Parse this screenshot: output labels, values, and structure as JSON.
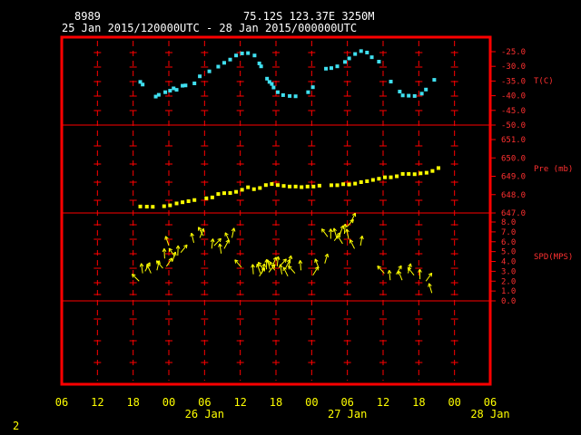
{
  "header": {
    "station_id": "8989",
    "location": "75.12S   123.37E   3250M",
    "date_range": "25 Jan 2015/120000UTC - 28 Jan 2015/000000UTC"
  },
  "page_number": "2",
  "colors": {
    "frame": "#ff0000",
    "grid": "#ff0000",
    "axis_text": "#ffff00",
    "header_text": "#ffffff",
    "temperature": "#40e0f0",
    "pressure": "#ffff00",
    "wind": "#ffff00",
    "right_labels": "#ff3030"
  },
  "chart_data": [
    {
      "type": "scatter",
      "ylabel": "T(C)",
      "ylim": [
        -50,
        -25
      ],
      "ticks": [
        "-25.0",
        "-30.0",
        "-35.0",
        "-40.0",
        "-45.0",
        "-50.0"
      ],
      "x": [
        13.2,
        13.6,
        15.8,
        16.3,
        17.4,
        18.2,
        18.8,
        19.3,
        20.3,
        20.8,
        22.3,
        23.2,
        24.8,
        26.3,
        27.3,
        28.3,
        29.3,
        30.3,
        31.3,
        32.4,
        33.2,
        33.5,
        34.5,
        34.9,
        35.3,
        35.6,
        36.3,
        37.2,
        38.3,
        39.3,
        41.4,
        42.2,
        44.4,
        45.3,
        46.3,
        47.6,
        48.3,
        49.3,
        50.3,
        51.3,
        52.1,
        53.3,
        55.3,
        56.8,
        57.3,
        58.3,
        59.3,
        60.5,
        61.2,
        62.6
      ],
      "y": [
        -35.3,
        -36.2,
        -40.3,
        -39.7,
        -38.8,
        -38.3,
        -37.5,
        -38.0,
        -36.6,
        -36.5,
        -35.8,
        -33.4,
        -31.7,
        -30.1,
        -28.8,
        -27.7,
        -26.3,
        -25.6,
        -25.5,
        -26.3,
        -29.0,
        -30.0,
        -34.2,
        -35.3,
        -36.0,
        -37.2,
        -38.8,
        -39.8,
        -40.1,
        -40.2,
        -38.8,
        -37.1,
        -30.8,
        -30.6,
        -30.0,
        -28.5,
        -27.3,
        -25.8,
        -24.8,
        -25.3,
        -26.9,
        -28.4,
        -35.2,
        -38.6,
        -39.9,
        -40.0,
        -40.1,
        -39.3,
        -37.9,
        -34.6
      ]
    },
    {
      "type": "scatter",
      "ylabel": "Pre (mb)",
      "ylim": [
        647,
        652
      ],
      "ticks": [
        "651.0",
        "650.0",
        "649.0",
        "648.0",
        "647.0"
      ],
      "x": [
        13.2,
        14.3,
        15.3,
        17.2,
        18.2,
        19.3,
        20.3,
        21.3,
        22.3,
        24.3,
        25.3,
        26.3,
        27.3,
        28.3,
        29.3,
        30.3,
        31.3,
        32.3,
        33.3,
        34.3,
        35.3,
        36.3,
        37.3,
        38.3,
        39.3,
        40.3,
        41.3,
        42.3,
        43.3,
        45.3,
        46.3,
        47.3,
        48.3,
        49.3,
        50.3,
        51.3,
        52.3,
        53.3,
        54.3,
        55.3,
        56.3,
        57.3,
        58.3,
        59.3,
        60.3,
        61.3,
        62.3,
        63.3
      ],
      "y": [
        647.44,
        647.43,
        647.42,
        647.46,
        647.52,
        647.65,
        647.73,
        647.8,
        647.88,
        648.0,
        648.06,
        648.29,
        648.35,
        648.36,
        648.44,
        648.58,
        648.75,
        648.62,
        648.7,
        648.9,
        648.97,
        648.9,
        648.84,
        648.8,
        648.8,
        648.76,
        648.8,
        648.8,
        648.86,
        648.89,
        648.89,
        648.96,
        648.94,
        649.0,
        649.1,
        649.16,
        649.25,
        649.33,
        649.43,
        649.43,
        649.5,
        649.66,
        649.66,
        649.64,
        649.7,
        649.74,
        649.86,
        650.06
      ]
    },
    {
      "type": "scatter",
      "ylabel": "SPD(MPS)",
      "ylim": [
        0,
        8
      ],
      "ticks": [
        "8.0",
        "7.0",
        "6.0",
        "5.0",
        "4.0",
        "3.0",
        "2.0",
        "1.0",
        "0.0"
      ],
      "x": [
        13.0,
        13.6,
        14.0,
        15.0,
        16.0,
        17.0,
        17.3,
        17.6,
        18.0,
        18.6,
        19.0,
        19.5,
        20.0,
        22.2,
        23.2,
        23.8,
        25.2,
        25.6,
        26.8,
        27.3,
        28.2,
        28.6,
        30.2,
        32.2,
        33.2,
        33.4,
        33.6,
        34.0,
        34.4,
        34.8,
        35.0,
        35.4,
        35.8,
        36.2,
        36.6,
        37.0,
        37.6,
        38.0,
        38.2,
        39.2,
        40.2,
        42.2,
        43.2,
        44.2,
        44.7,
        45.2,
        45.8,
        46.2,
        46.7,
        47.2,
        47.5,
        47.9,
        48.2,
        48.6,
        49.2,
        50.2,
        54.2,
        55.2,
        56.2,
        57.2,
        58.2,
        59.2,
        60.2,
        61.2,
        62.2
      ],
      "y": [
        2.0,
        2.8,
        3.0,
        2.8,
        3.1,
        3.3,
        4.3,
        3.5,
        5.6,
        4.0,
        4.5,
        4.6,
        4.9,
        5.9,
        6.4,
        6.6,
        5.3,
        5.6,
        4.8,
        5.3,
        6.0,
        6.4,
        3.4,
        2.7,
        2.5,
        2.8,
        2.8,
        3.1,
        3.2,
        2.9,
        3.2,
        3.5,
        3.1,
        3.5,
        3.5,
        2.7,
        3.3,
        2.5,
        3.6,
        2.8,
        3.1,
        2.6,
        3.3,
        3.8,
        6.5,
        6.3,
        6.1,
        6.4,
        6.7,
        5.8,
        6.8,
        7.5,
        6.3,
        8.0,
        5.3,
        5.6,
        2.8,
        2.1,
        2.7,
        2.1,
        2.8,
        2.6,
        2.2,
        2.0,
        0.8
      ]
    },
    {
      "type": "scatter",
      "axis_x": {
        "hours_per_unit": 1,
        "tick_hour_labels": [
          "06",
          "12",
          "18",
          "00",
          "06",
          "12",
          "18",
          "00",
          "06",
          "12",
          "18",
          "00",
          "06"
        ],
        "date_labels": [
          {
            "text": "26 Jan",
            "at_hour": 24
          },
          {
            "text": "27 Jan",
            "at_hour": 48
          },
          {
            "text": "28 Jan",
            "at_hour": 72
          }
        ]
      }
    }
  ]
}
